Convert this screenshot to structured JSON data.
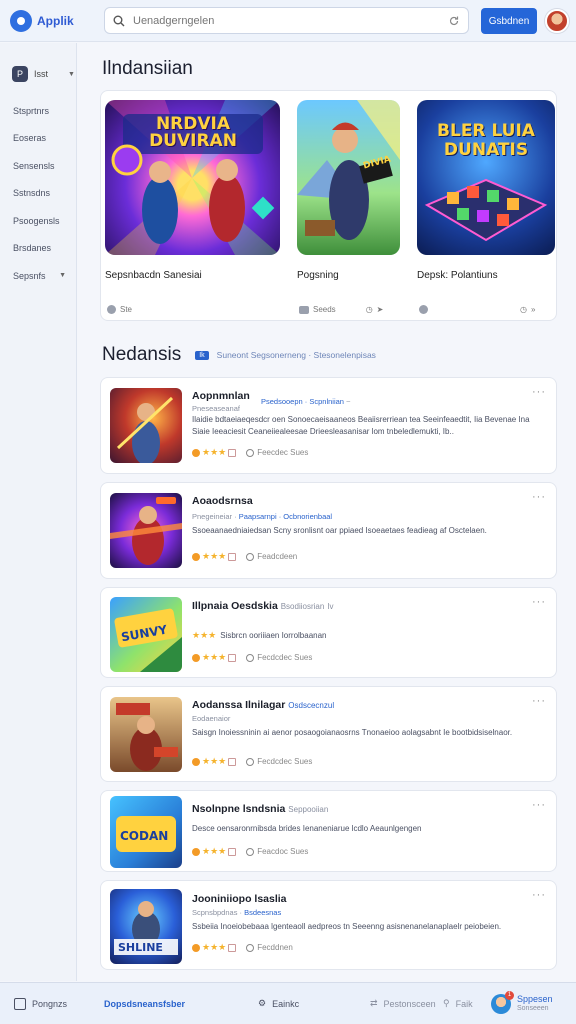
{
  "header": {
    "app_name": "Applik",
    "search_placeholder": "Uenadgerngelen",
    "action_label": "Gsbdnen"
  },
  "sidebar": {
    "top_label": "Isst",
    "items": [
      {
        "label": "Stsprtnrs"
      },
      {
        "label": "Eoseras"
      },
      {
        "label": "Sensensls"
      },
      {
        "label": "Sstnsdns"
      },
      {
        "label": "Psoogensls"
      },
      {
        "label": "Brsdanes"
      },
      {
        "label": "Sepsnfs",
        "caret": true
      }
    ]
  },
  "featured": {
    "title": "Ilndansiian",
    "cards": [
      {
        "art_text": "NRDVIA DUVIRAN",
        "title": "Sepsnbacdn Sanesiai",
        "meta_left": "Ste",
        "meta_right": ""
      },
      {
        "art_text": "DIVIA",
        "title": "Pogsning",
        "meta_left": "Seeds",
        "meta_right": ""
      },
      {
        "art_text": "BLER LUIA DUNATIS",
        "title": "Depsk: Polantiuns",
        "meta_left": "",
        "meta_right": ""
      }
    ]
  },
  "list": {
    "title": "Nedansis",
    "chip": "Ik",
    "subtitle": "Suneont Segsonerneng · Stesonelenpisas",
    "items": [
      {
        "title": "Aopnmnlan",
        "sub_plain": "Pneseaseanaf",
        "sub_hl": "Psedsooepn · Scpnlniian",
        "sub_tail": "~",
        "desc": "Ilaidie bdtaeiaeqesdcr oen Sonoecaeisaaneos Beaiisrerriean tea Seeinfeaedtit, Iia Bevenae Ina Siaie Ieeaciesit Ceaneiiealeesae Drieesleasanisar lom tnbeledlemukti, Ib..",
        "rating_text": "Feecdec Sues"
      },
      {
        "title": "Aoaodsrnsa",
        "sub_plain": "Pnegeineiar",
        "sub_hl": "Paapsarnpi · Ocbnorienbaal",
        "sub_tail": "",
        "desc": "Ssoeaanaedniaiedsan Scny sronlisnt oar ppiaed Isoeaetaes feadieag af Osctelaen.",
        "rating_text": "Feadcdeen"
      },
      {
        "title": "Illpnaia Oesdskia",
        "sub_plain": "Bsodiiosrian",
        "sub_hl": "",
        "sub_tail": "Iv",
        "desc": "Sisbrcn ooriiiaen Iorrolbaanan",
        "rating_text": "Fecdcdec Sues"
      },
      {
        "title": "Aodanssa Ilnilagar",
        "sub_plain": "Eodaenaior",
        "sub_hl": "Osdscecnzul",
        "sub_tail": "",
        "desc": "Saisgn Inoiessninin ai aenor posaogoianaosrns Tnonaeioo aolagsabnt Ie bootbidsiselnaor.",
        "rating_text": "Fecdcdec Sues"
      },
      {
        "title": "Nsolnpne lsndsnia",
        "sub_plain": "Seppooiian",
        "sub_hl": "",
        "sub_tail": "",
        "desc": "Desce oensaronrnibsda brides Ienaneniarue lcdlo Aeaunlgengen",
        "rating_text": "Feacdoc Sues"
      },
      {
        "title": "Jooniniiopo lsaslia",
        "sub_plain": "Scpnsbpdnas",
        "sub_hl": "Bsdeesnas",
        "sub_tail": "",
        "desc": "Ssbeiia Inoeiobebaaa lgenteaoll aedpreos tn Seeenng asisnenanelanaplaelr peiobeien.",
        "rating_text": "Fecddnen"
      }
    ]
  },
  "bottom_nav": {
    "items": [
      {
        "label": "Pongnzs"
      },
      {
        "label": "Dopsdsneansfsber"
      },
      {
        "label": "Eainkc"
      },
      {
        "label": "Pestonsceen"
      },
      {
        "label": "Faik"
      }
    ],
    "profile_label": "Sppesen",
    "profile_sub": "Sonseeen",
    "notif_count": "1"
  },
  "colors": {
    "accent": "#2566d8",
    "star": "#f5b32d",
    "rating_dot": "#f39b27"
  }
}
